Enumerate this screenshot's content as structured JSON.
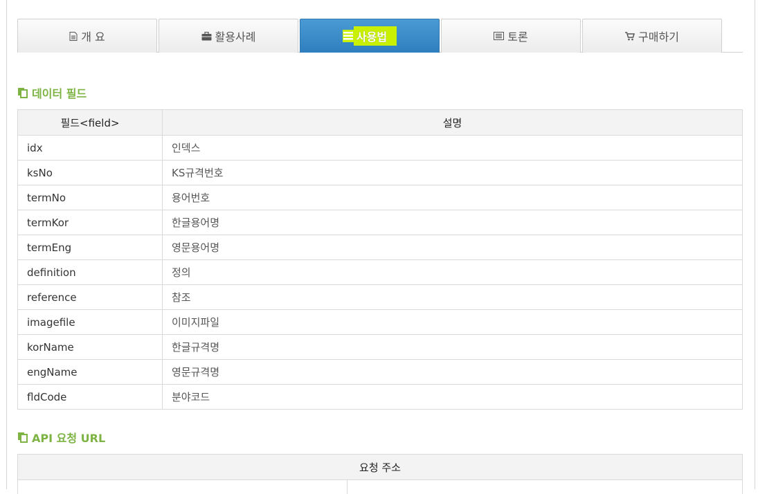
{
  "tabs": [
    {
      "label": "개 요",
      "icon": "document-icon"
    },
    {
      "label": "활용사례",
      "icon": "briefcase-icon"
    },
    {
      "label": "사용법",
      "icon": "list-icon",
      "active": true
    },
    {
      "label": "토론",
      "icon": "comment-list-icon"
    },
    {
      "label": "구매하기",
      "icon": "cart-icon"
    }
  ],
  "sections": {
    "data_field_title": "데이터 필드",
    "api_title": "API 요청 URL"
  },
  "fields_table": {
    "headers": [
      "필드<field>",
      "설명"
    ],
    "rows": [
      [
        "idx",
        "인덱스"
      ],
      [
        "ksNo",
        "KS규격번호"
      ],
      [
        "termNo",
        "용어번호"
      ],
      [
        "termKor",
        "한글용어명"
      ],
      [
        "termEng",
        "영문용어명"
      ],
      [
        "definition",
        "정의"
      ],
      [
        "reference",
        "참조"
      ],
      [
        "imagefile",
        "이미지파일"
      ],
      [
        "korName",
        "한글규격명"
      ],
      [
        "engName",
        "영문규격명"
      ],
      [
        "fldCode",
        "분야코드"
      ]
    ]
  },
  "api_table": {
    "header": "요청 주소"
  },
  "colors": {
    "accent_green": "#7cb342",
    "active_tab": "#3a8ccb",
    "highlight": "#c8f000"
  }
}
